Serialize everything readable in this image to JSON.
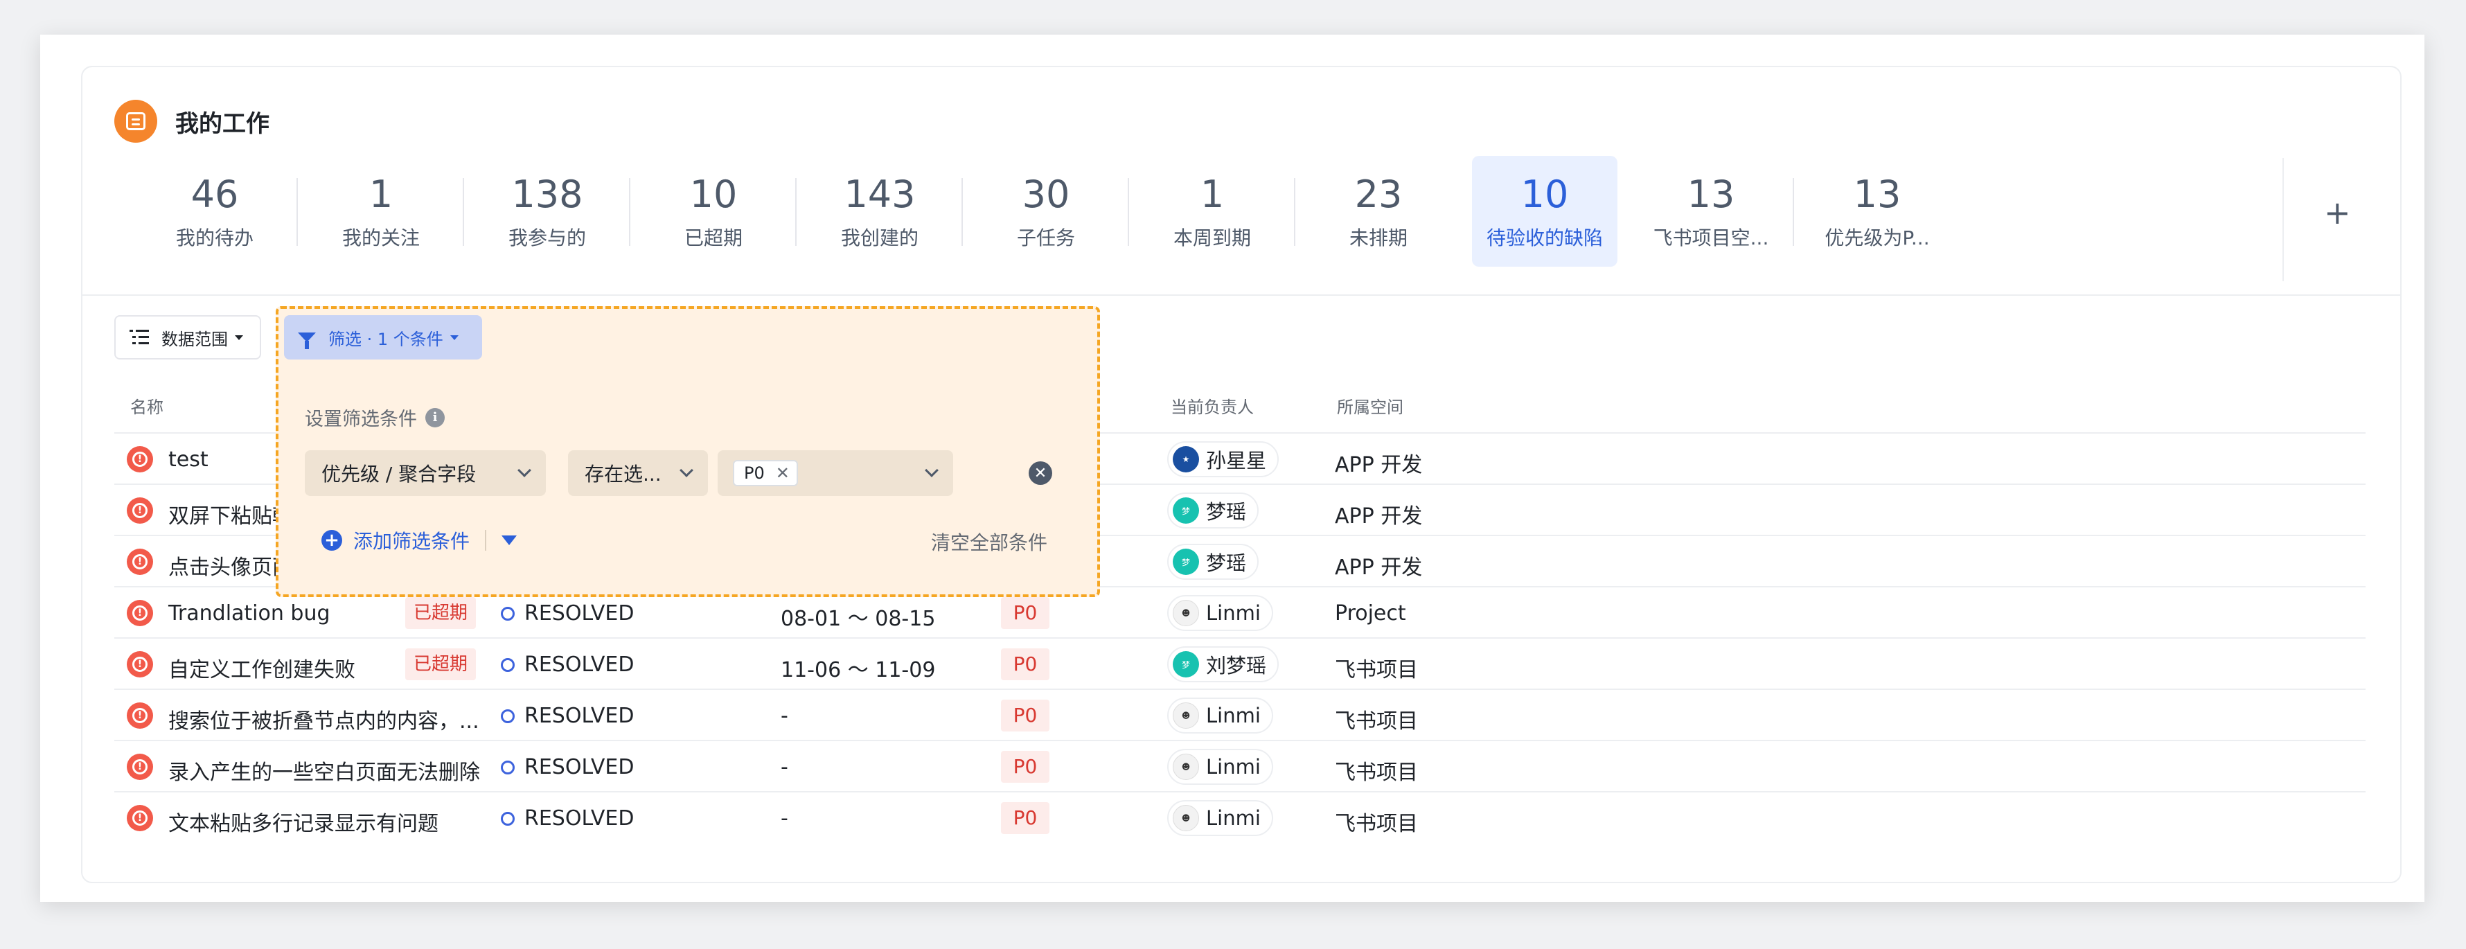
{
  "header": {
    "title": "我的工作"
  },
  "stats": [
    {
      "num": "46",
      "label": "我的待办"
    },
    {
      "num": "1",
      "label": "我的关注"
    },
    {
      "num": "138",
      "label": "我参与的"
    },
    {
      "num": "10",
      "label": "已超期"
    },
    {
      "num": "143",
      "label": "我创建的"
    },
    {
      "num": "30",
      "label": "子任务"
    },
    {
      "num": "1",
      "label": "本周到期"
    },
    {
      "num": "23",
      "label": "未排期"
    },
    {
      "num": "10",
      "label": "待验收的缺陷"
    },
    {
      "num": "13",
      "label": "飞书项目空..."
    },
    {
      "num": "13",
      "label": "优先级为P..."
    }
  ],
  "add_view_label": "+",
  "toolbar": {
    "scope_label": "数据范围",
    "filter_label": "筛选 · 1 个条件"
  },
  "columns": {
    "name": "名称",
    "owner": "当前负责人",
    "space": "所属空间"
  },
  "filter_panel": {
    "title": "设置筛选条件",
    "field": "优先级 / 聚合字段",
    "operator": "存在选...",
    "value_tag": "P0",
    "add_label": "添加筛选条件",
    "clear_label": "清空全部条件"
  },
  "rows": [
    {
      "name": "test",
      "owner": "孙星星",
      "space": "APP 开发"
    },
    {
      "name": "双屏下粘贴韩",
      "owner": "梦瑶",
      "space": "APP 开发"
    },
    {
      "name": "点击头像页面",
      "owner": "梦瑶",
      "space": "APP 开发"
    },
    {
      "name": "Trandlation bug",
      "overdue": "已超期",
      "status": "RESOLVED",
      "dates": "08-01 ～ 08-15",
      "priority": "P0",
      "owner": "Linmi",
      "space": "Project"
    },
    {
      "name": "自定义工作创建失败",
      "overdue": "已超期",
      "status": "RESOLVED",
      "dates": "11-06 ～ 11-09",
      "priority": "P0",
      "owner": "刘梦瑶",
      "space": "飞书项目"
    },
    {
      "name": "搜索位于被折叠节点内的内容，...",
      "status": "RESOLVED",
      "dates": "-",
      "priority": "P0",
      "owner": "Linmi",
      "space": "飞书项目"
    },
    {
      "name": "录入产生的一些空白页面无法删除",
      "status": "RESOLVED",
      "dates": "-",
      "priority": "P0",
      "owner": "Linmi",
      "space": "飞书项目"
    },
    {
      "name": "文本粘贴多行记录显示有问题",
      "status": "RESOLVED",
      "dates": "-",
      "priority": "P0",
      "owner": "Linmi",
      "space": "飞书项目"
    }
  ],
  "colors": {
    "accent": "#2b5fd9",
    "brand_orange": "#f5852c",
    "overdue_red": "#d83931",
    "highlight_dashed": "#f5a623"
  }
}
